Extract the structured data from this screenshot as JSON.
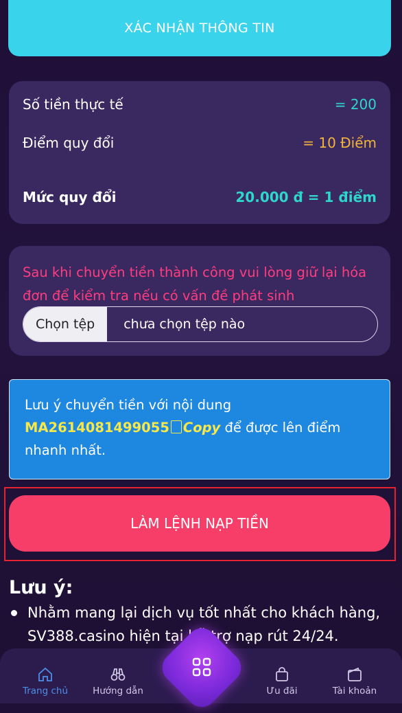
{
  "confirm_button": "XÁC NHẬN THÔNG TIN",
  "summary": {
    "actual_amount_label": "Số tiền thực tế",
    "actual_amount_value": "= 200",
    "points_label": "Điểm quy đổi",
    "points_value": "= 10 Điểm",
    "rate_label": "Mức quy đổi",
    "rate_value": "20.000 đ = 1 điểm"
  },
  "upload": {
    "note": "Sau khi chuyển tiền thành công vui lòng giữ lại hóa đơn để kiểm tra nếu có vấn đề phát sinh",
    "choose_file": "Chọn tệp",
    "status": "chưa chọn tệp nào"
  },
  "notice": {
    "prefix": "Lưu ý chuyển tiền với nội dung",
    "code": "MA2614081499055",
    "copy": "Copy",
    "suffix": "để được lên điểm nhanh nhất."
  },
  "deposit_button": "LÀM LỆNH NẠP TIỀN",
  "notes": {
    "title": "Lưu ý:",
    "items": [
      "Nhằm mang lại dịch vụ tốt nhất cho khách hàng, SV388.casino hiện tại hỗ trợ nạp rút 24/24."
    ]
  },
  "tabbar": {
    "home": "Trang chủ",
    "guide": "Hướng dẫn",
    "offers": "Ưu đãi",
    "account": "Tài khoản"
  },
  "colors": {
    "accent_cyan": "#3ad3ec",
    "primary_pink": "#f63e68",
    "active_tab": "#4d8ee8"
  }
}
